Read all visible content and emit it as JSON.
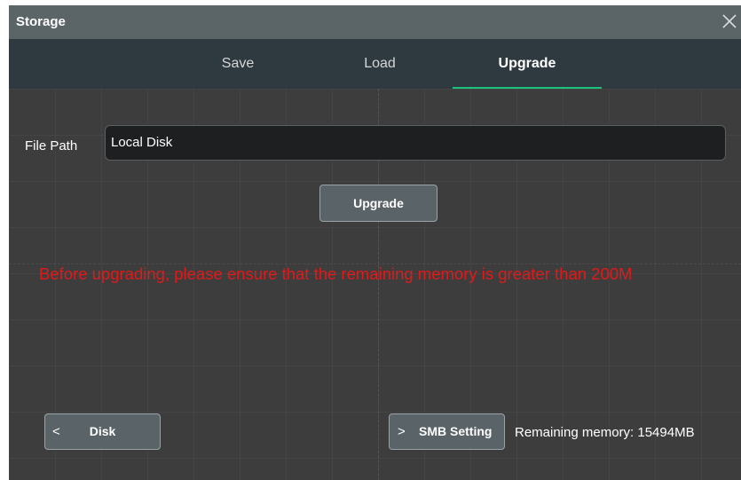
{
  "window": {
    "title": "Storage",
    "close_icon": "close-icon"
  },
  "tabs": [
    {
      "label": "Save",
      "active": false
    },
    {
      "label": "Load",
      "active": false
    },
    {
      "label": "Upgrade",
      "active": true
    }
  ],
  "file_path": {
    "label": "File Path",
    "value": "Local Disk"
  },
  "upgrade_button": "Upgrade",
  "warning": "Before upgrading, please ensure that the remaining memory is greater than 200M",
  "disk_button": {
    "label": "Disk",
    "icon": "chevron-left-icon"
  },
  "smb_button": {
    "label": "SMB Setting",
    "icon": "chevron-right-icon"
  },
  "remaining_memory": "Remaining memory: 15494MB",
  "colors": {
    "title_bar": "#5b6467",
    "tab_bar": "#2f3a40",
    "background": "#3d3d3d",
    "accent": "#19c37d",
    "warning": "#e01a1a",
    "button": "#5a6367"
  }
}
